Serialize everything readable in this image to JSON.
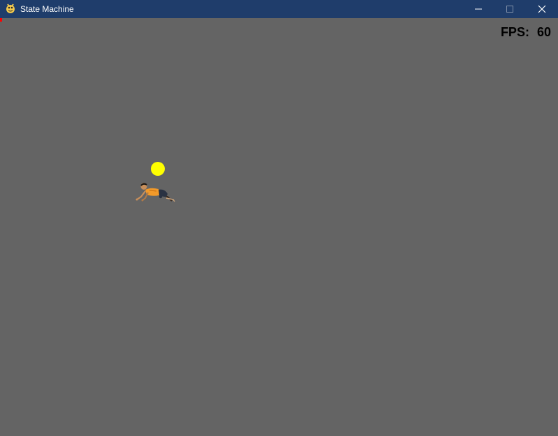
{
  "window": {
    "title": "State Machine",
    "controls": {
      "minimize_icon": "minimize-icon",
      "maximize_icon": "maximize-icon",
      "close_icon": "close-icon"
    },
    "app_icon": "pygame-snake-icon",
    "titlebar_color": "#1f3d6b"
  },
  "game": {
    "background_color": "#646464",
    "hud": {
      "fps_label": "FPS:",
      "fps_value": "60"
    },
    "entities": {
      "target": {
        "shape": "circle",
        "color": "#ffff00"
      },
      "player": {
        "sprite": "crawling-person"
      }
    }
  }
}
